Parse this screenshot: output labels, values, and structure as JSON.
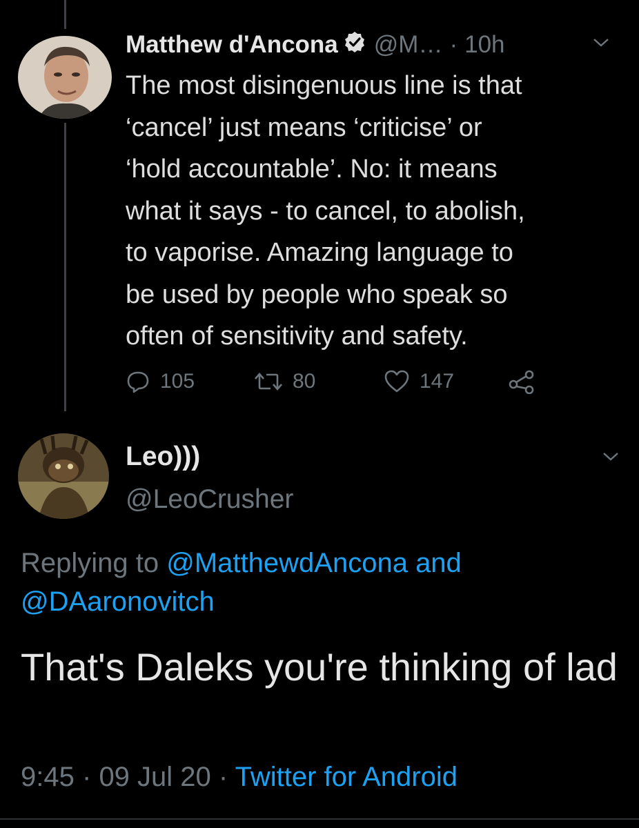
{
  "colors": {
    "background": "#000000",
    "text": "#d9d9d9",
    "muted": "#6e767d",
    "link": "#1da1f2",
    "thread_line": "#3d4148"
  },
  "parent_tweet": {
    "author_name": "Matthew d'Ancona",
    "verified_icon": "verified-badge-icon",
    "handle": "@M…",
    "separator": "·",
    "time_ago": "10h",
    "body_lines": [
      "The most disingenuous line is that",
      "‘cancel’ just means ‘criticise’ or",
      "‘hold accountable’. No: it means",
      "what it says - to cancel, to abolish,",
      "to vaporise. Amazing language to",
      "be used by people who speak so",
      "often of sensitivity and safety."
    ],
    "actions": {
      "reply_count": "105",
      "retweet_count": "80",
      "like_count": "147"
    }
  },
  "reply_tweet": {
    "author_name": "Leo)))",
    "handle": "@LeoCrusher",
    "replying_prefix": "Replying to",
    "replying_user1": "@MatthewdAncona",
    "replying_and": "and",
    "replying_user2": "@DAaronovitch",
    "body": "That's Daleks you're thinking of lad",
    "time": "9:45",
    "dot1": "·",
    "date": "09 Jul 20",
    "dot2": "·",
    "client": "Twitter for Android"
  }
}
